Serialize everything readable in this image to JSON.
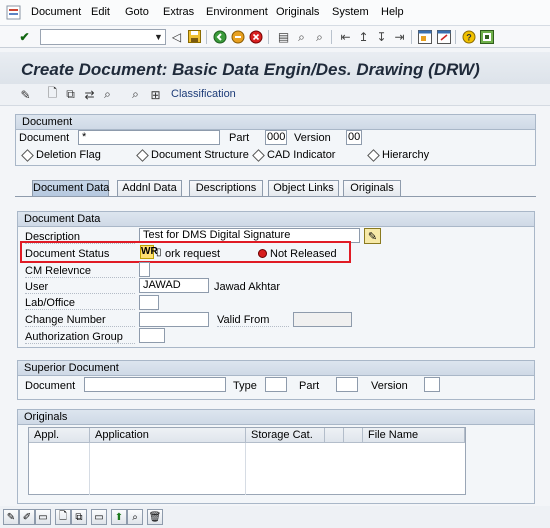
{
  "menu": {
    "items": [
      "Document",
      "Edit",
      "Goto",
      "Extras",
      "Environment",
      "Originals",
      "System",
      "Help"
    ]
  },
  "toolbar": {
    "command_field": "",
    "icons": [
      "enter-icon",
      "back-icon",
      "save-icon",
      "back-green-icon",
      "exit-icon",
      "cancel-icon",
      "print-icon",
      "find-icon",
      "find-next-icon",
      "first-page-icon",
      "prev-page-icon",
      "next-page-icon",
      "last-page-icon",
      "create-session-icon",
      "shortcut-icon",
      "help-icon",
      "customize-layout-icon"
    ]
  },
  "title": "Create Document: Basic Data Engin/Des. Drawing (DRW)",
  "app_toolbar": {
    "classification_label": "Classification"
  },
  "document_group": {
    "title": "Document",
    "document_label": "Document",
    "document_value": "*",
    "part_label": "Part",
    "part_value": "000",
    "version_label": "Version",
    "version_value": "00",
    "radios": [
      "Deletion Flag",
      "Document Structure",
      "CAD Indicator",
      "Hierarchy"
    ]
  },
  "tabs": [
    "Document Data",
    "Addnl Data",
    "Descriptions",
    "Object Links",
    "Originals"
  ],
  "document_data": {
    "title": "Document Data",
    "description_label": "Description",
    "description_value": "Test for DMS Digital Signature",
    "status_label": "Document Status",
    "status_code": "WR",
    "status_text": "ork request",
    "status_release": "Not Released",
    "cm_label": "CM Relevnce",
    "user_label": "User",
    "user_value": "JAWAD",
    "user_name": "Jawad Akhtar",
    "lab_label": "Lab/Office",
    "change_label": "Change Number",
    "valid_from_label": "Valid From",
    "auth_label": "Authorization Group"
  },
  "superior": {
    "title": "Superior Document",
    "document_label": "Document",
    "type_label": "Type",
    "part_label": "Part",
    "version_label": "Version"
  },
  "originals": {
    "title": "Originals",
    "columns": [
      "Appl.",
      "Application",
      "Storage Cat.",
      "File Name"
    ]
  },
  "colors": {
    "highlight": "#e01b25",
    "status_led": "#d81e1e"
  }
}
